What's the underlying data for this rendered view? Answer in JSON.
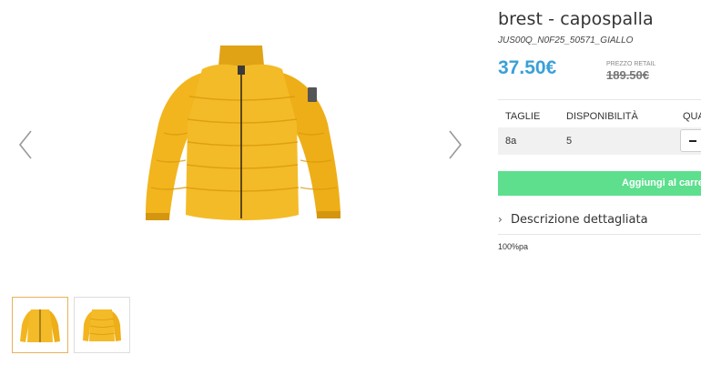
{
  "product": {
    "title": "brest - capospalla",
    "sku": "JUS00Q_N0F25_50571_GIALLO",
    "price": "37.50€",
    "retail_label": "PREZZO RETAIL",
    "retail_price": "189.50€"
  },
  "table": {
    "headers": [
      "TAGLIE",
      "DISPONIBILITÀ",
      "QUA"
    ],
    "rows": [
      {
        "size": "8a",
        "availability": "5"
      }
    ]
  },
  "add_to_cart_label": "Aggiungi al carrello",
  "description": {
    "toggle_label": "Descrizione dettagliata",
    "text": "100%pa"
  },
  "colors": {
    "price": "#3aa0d8",
    "button": "#5ddf8e",
    "jacket": "#f2b51e"
  },
  "icons": {
    "prev": "chevron-left-icon",
    "next": "chevron-right-icon",
    "toggle": "chevron-right-icon",
    "qty_minus": "minus-icon"
  }
}
